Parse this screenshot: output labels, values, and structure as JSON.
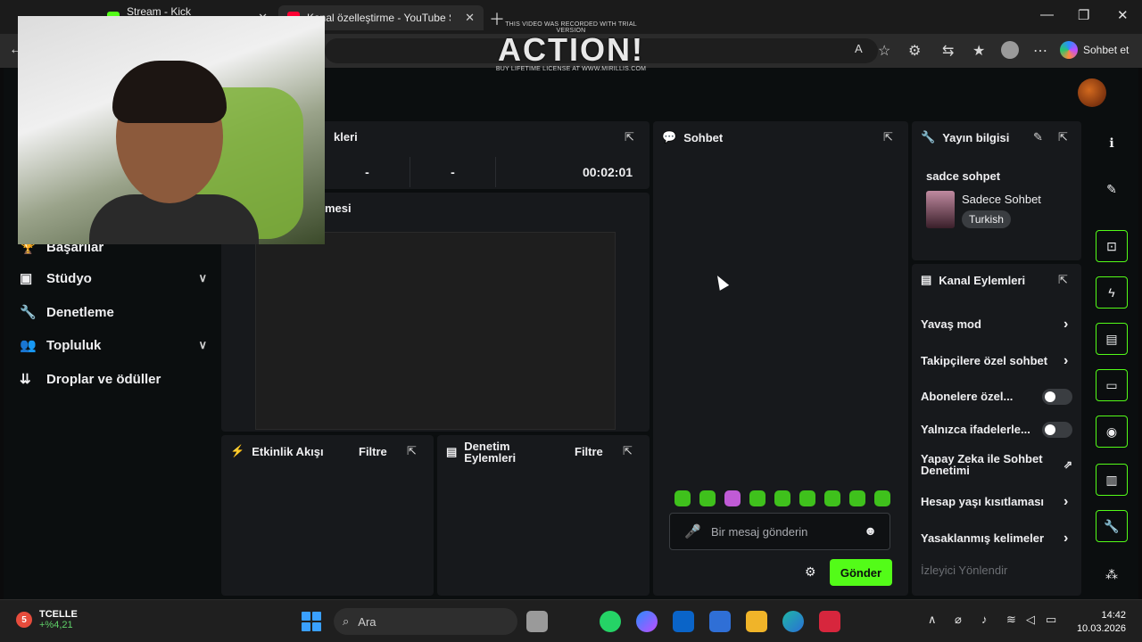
{
  "browser": {
    "tabs": [
      {
        "label": "Stream - Kick Dashboard",
        "active": false
      },
      {
        "label": "Kanal özelleştirme - YouTube Studi",
        "active": true
      }
    ],
    "new_tab_icon": "plus-icon",
    "window_controls": [
      "minimize-icon",
      "maximize-icon",
      "close-icon"
    ],
    "copilot_label": "Sohbet et"
  },
  "watermark": {
    "top_line": "THIS VIDEO WAS RECORDED WITH TRIAL VERSION",
    "brand": "ACTION!",
    "bottom_line": "BUY LIFETIME LICENSE AT WWW.MIRILLIS.COM"
  },
  "sidebar": {
    "items": [
      {
        "label": "Başarılar",
        "icon": "trophy-icon",
        "expandable": false
      },
      {
        "label": "Stüdyo",
        "icon": "studio-icon",
        "expandable": true
      },
      {
        "label": "Denetleme",
        "icon": "wrench-icon",
        "expandable": false
      },
      {
        "label": "Topluluk",
        "icon": "community-icon",
        "expandable": true
      },
      {
        "label": "Droplar ve ödüller",
        "icon": "drops-icon",
        "expandable": false
      }
    ]
  },
  "stats_panel": {
    "title_fragment": "kleri",
    "values": [
      "-",
      "-",
      "00:02:01"
    ]
  },
  "preview_panel": {
    "title_fragment": "mesi"
  },
  "activity_feed": {
    "title": "Etkinlik Akışı",
    "filter_label": "Filtre"
  },
  "moderation_actions": {
    "title": "Denetim Eylemleri",
    "filter_label": "Filtre"
  },
  "chat": {
    "title": "Sohbet",
    "input_placeholder": "Bir mesaj gönderin",
    "send_label": "Gönder",
    "emote_count": 9
  },
  "stream_info": {
    "title": "Yayın bilgisi",
    "stream_title": "sadce sohpet",
    "category": "Sadece Sohbet",
    "language_tag": "Turkish"
  },
  "channel_actions": {
    "title": "Kanal Eylemleri",
    "items": [
      {
        "label": "Yavaş mod",
        "control": "arrow"
      },
      {
        "label": "Takipçilere özel sohbet",
        "control": "arrow"
      },
      {
        "label": "Abonelere özel...",
        "control": "toggle",
        "on": false
      },
      {
        "label": "Yalnızca ifadelerle...",
        "control": "toggle",
        "on": false
      },
      {
        "label": "Yapay Zeka ile Sohbet Denetimi",
        "control": "external"
      },
      {
        "label": "Hesap yaşı kısıtlaması",
        "control": "arrow"
      },
      {
        "label": "Yasaklanmış kelimeler",
        "control": "arrow"
      }
    ],
    "muted_item": "İzleyici Yönlendir"
  },
  "right_rail": [
    "info-icon",
    "pencil-icon",
    "capture-icon",
    "bolt-icon",
    "notes-icon",
    "chat-icon",
    "broadcast-icon",
    "layout-icon",
    "wrench-icon",
    "share-icon"
  ],
  "taskbar": {
    "stock_name": "TCELLE",
    "stock_change": "+%4,21",
    "stock_badge": "5",
    "search_placeholder": "Ara",
    "time": "14:42",
    "date": "10.03.2026"
  },
  "colors": {
    "accent": "#53fc18",
    "panel_bg": "#17191c",
    "app_bg": "#0b0e0f"
  }
}
